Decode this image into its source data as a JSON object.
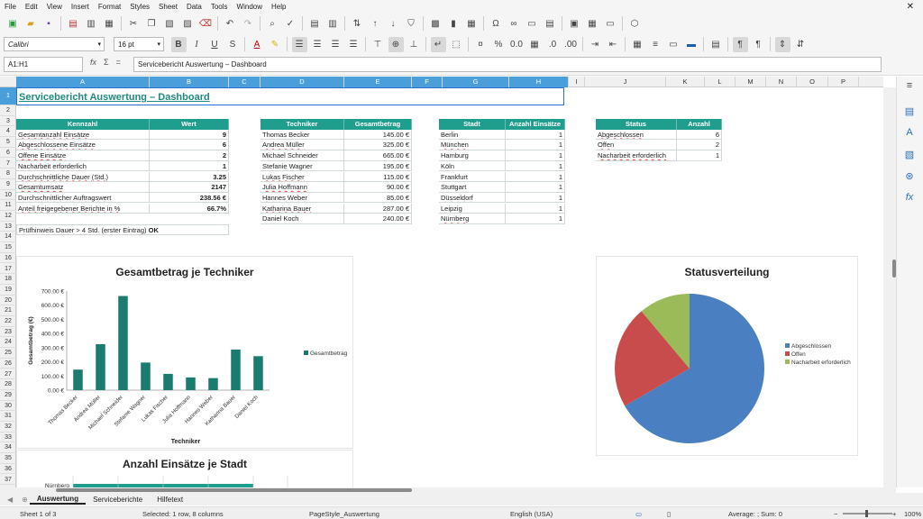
{
  "menu": [
    "File",
    "Edit",
    "View",
    "Insert",
    "Format",
    "Styles",
    "Sheet",
    "Data",
    "Tools",
    "Window",
    "Help"
  ],
  "close_glyph": "✕",
  "font_name": "Calibri",
  "font_size": "16 pt",
  "namebox": "A1:H1",
  "formula": "Servicebericht Auswertung – Dashboard",
  "columns": [
    "A",
    "B",
    "C",
    "D",
    "E",
    "F",
    "G",
    "H",
    "I",
    "J",
    "K",
    "L",
    "M",
    "N",
    "O",
    "P"
  ],
  "rows": [
    "1",
    "2",
    "3",
    "4",
    "5",
    "6",
    "7",
    "8",
    "9",
    "10",
    "11",
    "12",
    "13",
    "14",
    "15",
    "16",
    "17",
    "18",
    "19",
    "20",
    "21",
    "22",
    "23",
    "24",
    "25",
    "26",
    "27",
    "28",
    "29",
    "30",
    "31",
    "32",
    "33",
    "34",
    "35",
    "36",
    "37"
  ],
  "sheet_title": "Servicebericht Auswertung – Dashboard",
  "kennzahl": {
    "headers": [
      "Kennzahl",
      "Wert"
    ],
    "rows": [
      [
        "Gesamtanzahl Einsätze",
        "9"
      ],
      [
        "Abgeschlossene Einsätze",
        "6"
      ],
      [
        "Offene Einsätze",
        "2"
      ],
      [
        "Nacharbeit erforderlich",
        "1"
      ],
      [
        "Durchschnittliche Dauer (Std.)",
        "3.25"
      ],
      [
        "Gesamtumsatz",
        "2147"
      ],
      [
        "Durchschnittlicher Auftragswert",
        "238.56 €"
      ],
      [
        "Anteil freigegebener Berichte in %",
        "66.7%"
      ]
    ],
    "check_label": "Prüfhinweis Dauer > 4 Std. (erster Eintrag)",
    "check_value": "OK"
  },
  "techniker": {
    "headers": [
      "Techniker",
      "Gesamtbetrag"
    ],
    "rows": [
      [
        "Thomas Becker",
        "145.00 €"
      ],
      [
        "Andrea Müller",
        "325.00 €"
      ],
      [
        "Michael Schneider",
        "665.00 €"
      ],
      [
        "Stefanie Wagner",
        "195.00 €"
      ],
      [
        "Lukas Fischer",
        "115.00 €"
      ],
      [
        "Julia Hoffmann",
        "90.00 €"
      ],
      [
        "Hannes Weber",
        "85.00 €"
      ],
      [
        "Katharina Bauer",
        "287.00 €"
      ],
      [
        "Daniel Koch",
        "240.00 €"
      ]
    ]
  },
  "stadt": {
    "headers": [
      "Stadt",
      "Anzahl Einsätze"
    ],
    "rows": [
      [
        "Berlin",
        "1"
      ],
      [
        "München",
        "1"
      ],
      [
        "Hamburg",
        "1"
      ],
      [
        "Köln",
        "1"
      ],
      [
        "Frankfurt",
        "1"
      ],
      [
        "Stuttgart",
        "1"
      ],
      [
        "Düsseldorf",
        "1"
      ],
      [
        "Leipzig",
        "1"
      ],
      [
        "Nürnberg",
        "1"
      ]
    ]
  },
  "status": {
    "headers": [
      "Status",
      "Anzahl"
    ],
    "rows": [
      [
        "Abgeschlossen",
        "6"
      ],
      [
        "Offen",
        "2"
      ],
      [
        "Nacharbeit erforderlich",
        "1"
      ]
    ]
  },
  "chart_data": [
    {
      "type": "bar",
      "title": "Gesamtbetrag je Techniker",
      "xlabel": "Techniker",
      "ylabel": "Gesamtbetrag (€)",
      "categories": [
        "Thomas Becker",
        "Andrea Müller",
        "Michael Schneider",
        "Stefanie Wagner",
        "Lukas Fischer",
        "Julia Hoffmann",
        "Hannes Weber",
        "Katharina Bauer",
        "Daniel Koch"
      ],
      "series": [
        {
          "name": "Gesamtbetrag",
          "values": [
            145,
            325,
            665,
            195,
            115,
            90,
            85,
            287,
            240
          ]
        }
      ],
      "ylim": [
        0,
        700
      ],
      "yticks": [
        "0.00 €",
        "100.00 €",
        "200.00 €",
        "300.00 €",
        "400.00 €",
        "500.00 €",
        "600.00 €",
        "700.00 €"
      ],
      "legend": "right",
      "grid": false,
      "color": "#1a7c6e"
    },
    {
      "type": "pie",
      "title": "Statusverteilung",
      "categories": [
        "Abgeschlossen",
        "Offen",
        "Nacharbeit erforderlich"
      ],
      "values": [
        6,
        2,
        1
      ],
      "colors": [
        "#4a7fc1",
        "#c94c4c",
        "#9bbb59"
      ],
      "legend": "right"
    },
    {
      "type": "bar",
      "title": "Anzahl Einsätze je Stadt",
      "categories": [
        "Nürnberg"
      ],
      "values": [
        1
      ]
    }
  ],
  "sheet_tabs": [
    "Auswertung",
    "Serviceberichte",
    "Hilfetext"
  ],
  "active_tab": "Auswertung",
  "status_bar": {
    "sheet": "Sheet 1 of 3",
    "selected": "Selected: 1 row, 8 columns",
    "page_style": "PageStyle_Auswertung",
    "language": "English (USA)",
    "summary": "Average: ; Sum: 0",
    "zoom": "100%"
  }
}
